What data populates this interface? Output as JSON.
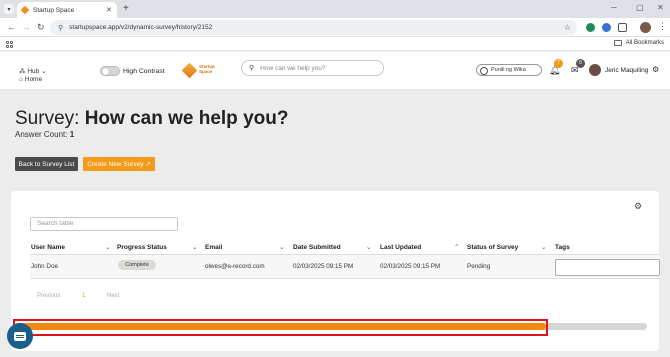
{
  "browser": {
    "tab_title": "Startup Space",
    "url": "startupspace.app/v2/dynamic-survey/history/2152",
    "bookmarks_label": "All Bookmarks"
  },
  "header": {
    "hub": "Hub",
    "home": "Home",
    "contrast_label": "High Contrast",
    "logo_text": "Startup Space",
    "search_placeholder": "How can we help you?",
    "language": "Punili ng Wika",
    "notifications_count": "7",
    "messages_count": "0",
    "user_name": "Jeric Maquiling"
  },
  "page": {
    "title_prefix": "Survey:",
    "title_main": "How can we help you?",
    "answer_label": "Answer Count:",
    "answer_count": "1",
    "back_button": "Back to Survey List",
    "create_button": "Create New Survey",
    "create_icon": "↗",
    "table_search_placeholder": "Search table"
  },
  "table": {
    "columns": [
      "User Name",
      "Progress Status",
      "Email",
      "Date Submitted",
      "Last Updated",
      "Status of Survey",
      "Tags"
    ],
    "rows": [
      {
        "user": "John Doe",
        "progress": "Complete",
        "email": "olwes@e-record.com",
        "submitted": "02/03/2025 09:15 PM",
        "updated": "02/03/2025 09:15 PM",
        "status": "Pending"
      }
    ]
  },
  "pagination": {
    "previous": "Previous",
    "page": "1",
    "next": "Next"
  },
  "scrollbar": {
    "progress": 0.84,
    "fill_color": "#f0890e",
    "track_color": "#d6d6d6"
  },
  "colors": {
    "accent": "#f49a1a",
    "dark_button": "#4a4a4a",
    "highlight": "#e0141e",
    "notification_badge": "#f49a1a",
    "message_badge": "#555555"
  }
}
